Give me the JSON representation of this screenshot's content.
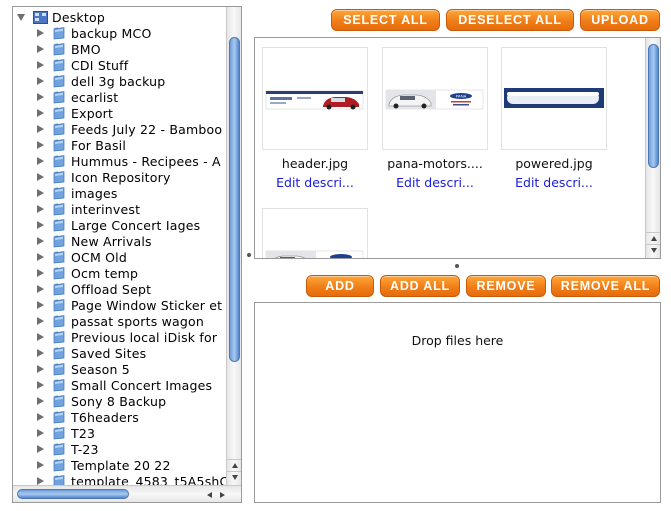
{
  "tree": {
    "root_label": "Desktop",
    "items": [
      {
        "label": "backup MCO"
      },
      {
        "label": "BMO"
      },
      {
        "label": "CDI Stuff"
      },
      {
        "label": "dell 3g backup"
      },
      {
        "label": "ecarlist"
      },
      {
        "label": "Export"
      },
      {
        "label": "Feeds July 22 - Bamboo"
      },
      {
        "label": "For Basil"
      },
      {
        "label": "Hummus - Recipees - A"
      },
      {
        "label": "Icon Repository"
      },
      {
        "label": "images"
      },
      {
        "label": "interinvest"
      },
      {
        "label": "Large Concert Iages"
      },
      {
        "label": "New Arrivals"
      },
      {
        "label": "OCM Old"
      },
      {
        "label": "Ocm temp"
      },
      {
        "label": "Offload Sept"
      },
      {
        "label": "Page Window Sticker et I"
      },
      {
        "label": "passat sports wagon"
      },
      {
        "label": "Previous local iDisk for"
      },
      {
        "label": "Saved Sites"
      },
      {
        "label": "Season 5"
      },
      {
        "label": "Small Concert Images"
      },
      {
        "label": "Sony 8 Backup"
      },
      {
        "label": "T6headers"
      },
      {
        "label": "T23"
      },
      {
        "label": "T-23"
      },
      {
        "label": "Template 20 22"
      },
      {
        "label": "template_4583_t5A5shC"
      }
    ],
    "folder_color": "#6fa3e0",
    "scrollbar_color": "#6f9ed8"
  },
  "toolbar_top": {
    "select_all": "SELECT ALL",
    "deselect_all": "DESELECT ALL",
    "upload": "UPLOAD"
  },
  "toolbar_bottom": {
    "add": "ADD",
    "add_all": "ADD ALL",
    "remove": "REMOVE",
    "remove_all": "REMOVE ALL"
  },
  "gallery": {
    "items": [
      {
        "name": "header.jpg",
        "edit_label": "Edit descri..."
      },
      {
        "name": "pana-motors....",
        "edit_label": "Edit descri..."
      },
      {
        "name": "powered.jpg",
        "edit_label": "Edit descri..."
      },
      {
        "name": "",
        "edit_label": ""
      }
    ]
  },
  "dropzone": {
    "text": "Drop files here"
  },
  "colors": {
    "button_orange": "#f07e18",
    "link_blue": "#1a1adc",
    "banner_navy": "#1f3a78"
  }
}
